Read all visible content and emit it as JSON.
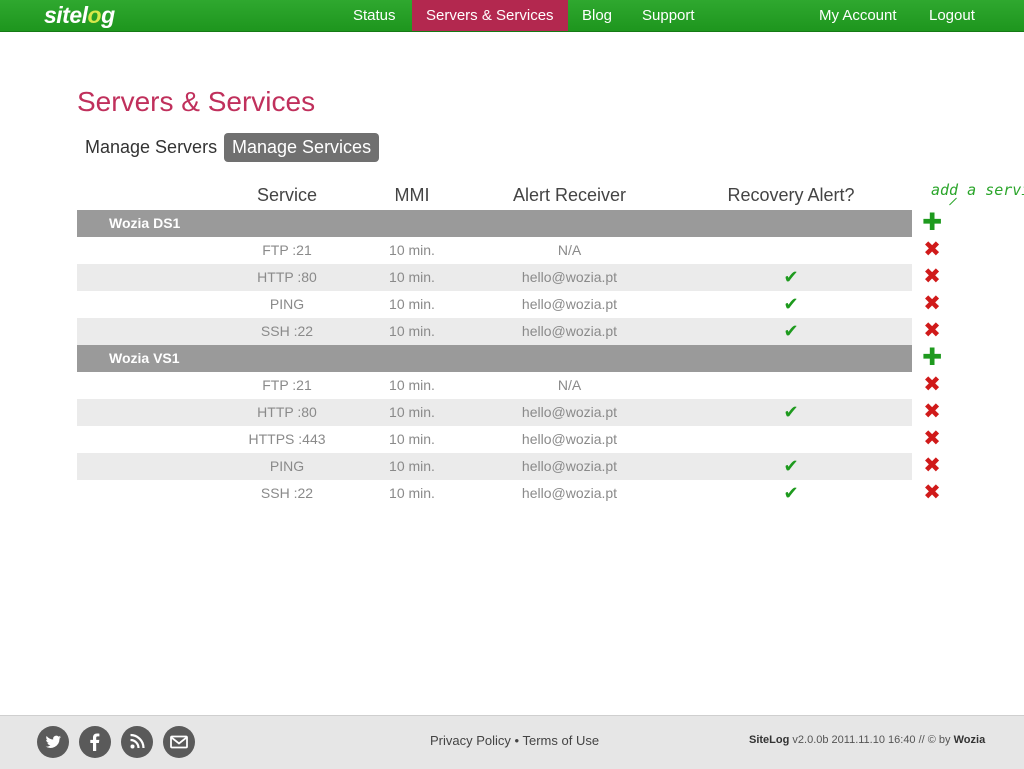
{
  "app": {
    "logo": {
      "text_a": "sitel",
      "text_o": "o",
      "text_b": "g"
    }
  },
  "nav": {
    "items": [
      {
        "label": "Status",
        "active": false
      },
      {
        "label": "Servers & Services",
        "active": true
      },
      {
        "label": "Blog",
        "active": false
      },
      {
        "label": "Support",
        "active": false
      }
    ],
    "account": "My Account",
    "logout": "Logout"
  },
  "page": {
    "title": "Servers & Services",
    "tabs": [
      {
        "label": "Manage Servers",
        "active": false
      },
      {
        "label": "Manage Services",
        "active": true
      }
    ]
  },
  "table": {
    "headers": {
      "service": "Service",
      "mmi": "MMI",
      "alert": "Alert Receiver",
      "recovery": "Recovery Alert?"
    },
    "hint": "add a service",
    "groups": [
      {
        "name": "Wozia DS1",
        "rows": [
          {
            "service": "FTP :21",
            "mmi": "10 min.",
            "alert": "N/A",
            "recovery": false
          },
          {
            "service": "HTTP :80",
            "mmi": "10 min.",
            "alert": "hello@wozia.pt",
            "recovery": true
          },
          {
            "service": "PING",
            "mmi": "10 min.",
            "alert": "hello@wozia.pt",
            "recovery": true
          },
          {
            "service": "SSH :22",
            "mmi": "10 min.",
            "alert": "hello@wozia.pt",
            "recovery": true
          }
        ]
      },
      {
        "name": "Wozia VS1",
        "rows": [
          {
            "service": "FTP :21",
            "mmi": "10 min.",
            "alert": "N/A",
            "recovery": false
          },
          {
            "service": "HTTP :80",
            "mmi": "10 min.",
            "alert": "hello@wozia.pt",
            "recovery": true
          },
          {
            "service": "HTTPS :443",
            "mmi": "10 min.",
            "alert": "hello@wozia.pt",
            "recovery": false
          },
          {
            "service": "PING",
            "mmi": "10 min.",
            "alert": "hello@wozia.pt",
            "recovery": true
          },
          {
            "service": "SSH :22",
            "mmi": "10 min.",
            "alert": "hello@wozia.pt",
            "recovery": true
          }
        ]
      }
    ]
  },
  "footer": {
    "social": [
      {
        "icon": "twitter-icon"
      },
      {
        "icon": "facebook-icon"
      },
      {
        "icon": "rss-icon"
      },
      {
        "icon": "email-icon"
      }
    ],
    "privacy": "Privacy Policy",
    "separator": "•",
    "terms": "Terms of Use",
    "app_name": "SiteLog",
    "version_text": "v2.0.0b 2011.11.10 16:40 // © by",
    "company": "Wozia"
  }
}
